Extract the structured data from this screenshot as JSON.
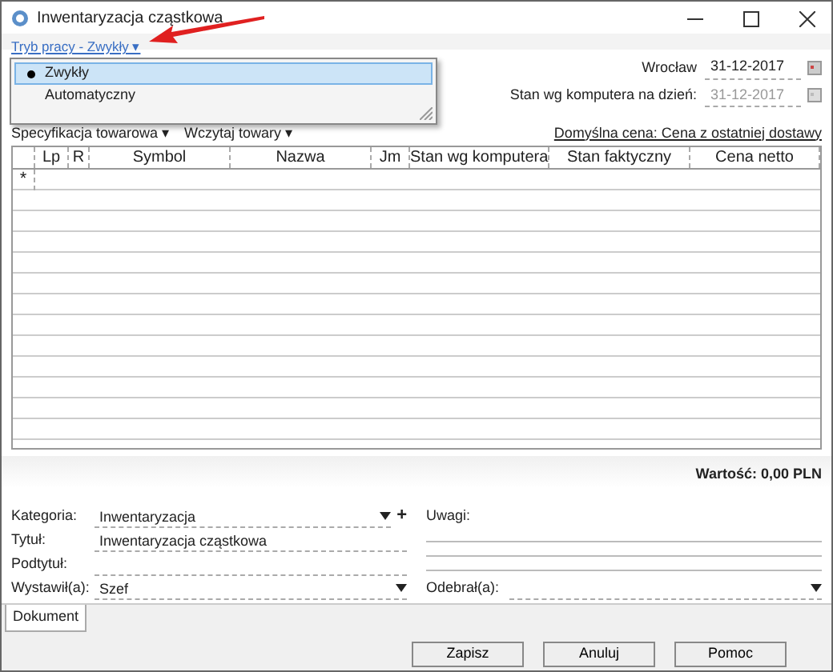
{
  "window": {
    "title": "Inwentaryzacja cząstkowa"
  },
  "mode_link": {
    "label": "Tryb pracy - Zwykły",
    "caret": "▾"
  },
  "mode_menu": {
    "items": [
      {
        "label": "Zwykły",
        "selected": true
      },
      {
        "label": "Automatyczny",
        "selected": false
      }
    ]
  },
  "header": {
    "place": "Wrocław",
    "date": "31-12-2017",
    "stock_date_label": "Stan wg komputera na dzień:",
    "stock_date": "31-12-2017"
  },
  "toolbar": {
    "menus": [
      {
        "label": "Specyfikacja towarowa",
        "caret": "▾"
      },
      {
        "label": "Wczytaj towary",
        "caret": "▾"
      }
    ],
    "default_price_link": "Domyślna cena: Cena z ostatniej dostawy"
  },
  "table": {
    "columns": [
      "",
      "Lp",
      "R",
      "Symbol",
      "Nazwa",
      "Jm",
      "Stan wg komputera",
      "Stan faktyczny",
      "Cena netto"
    ],
    "new_row_marker": "*"
  },
  "total": "Wartość: 0,00 PLN",
  "form": {
    "category_label": "Kategoria:",
    "category": "Inwentaryzacja",
    "title_label": "Tytuł:",
    "title": "Inwentaryzacja cząstkowa",
    "subtitle_label": "Podtytuł:",
    "issued_label": "Wystawił(a):",
    "issued": "Szef",
    "notes_label": "Uwagi:",
    "received_label": "Odebrał(a):",
    "add": "+"
  },
  "tabs": [
    {
      "label": "Dokument",
      "selected": true
    }
  ],
  "buttons": [
    "Zapisz",
    "Anuluj",
    "Pomoc"
  ]
}
